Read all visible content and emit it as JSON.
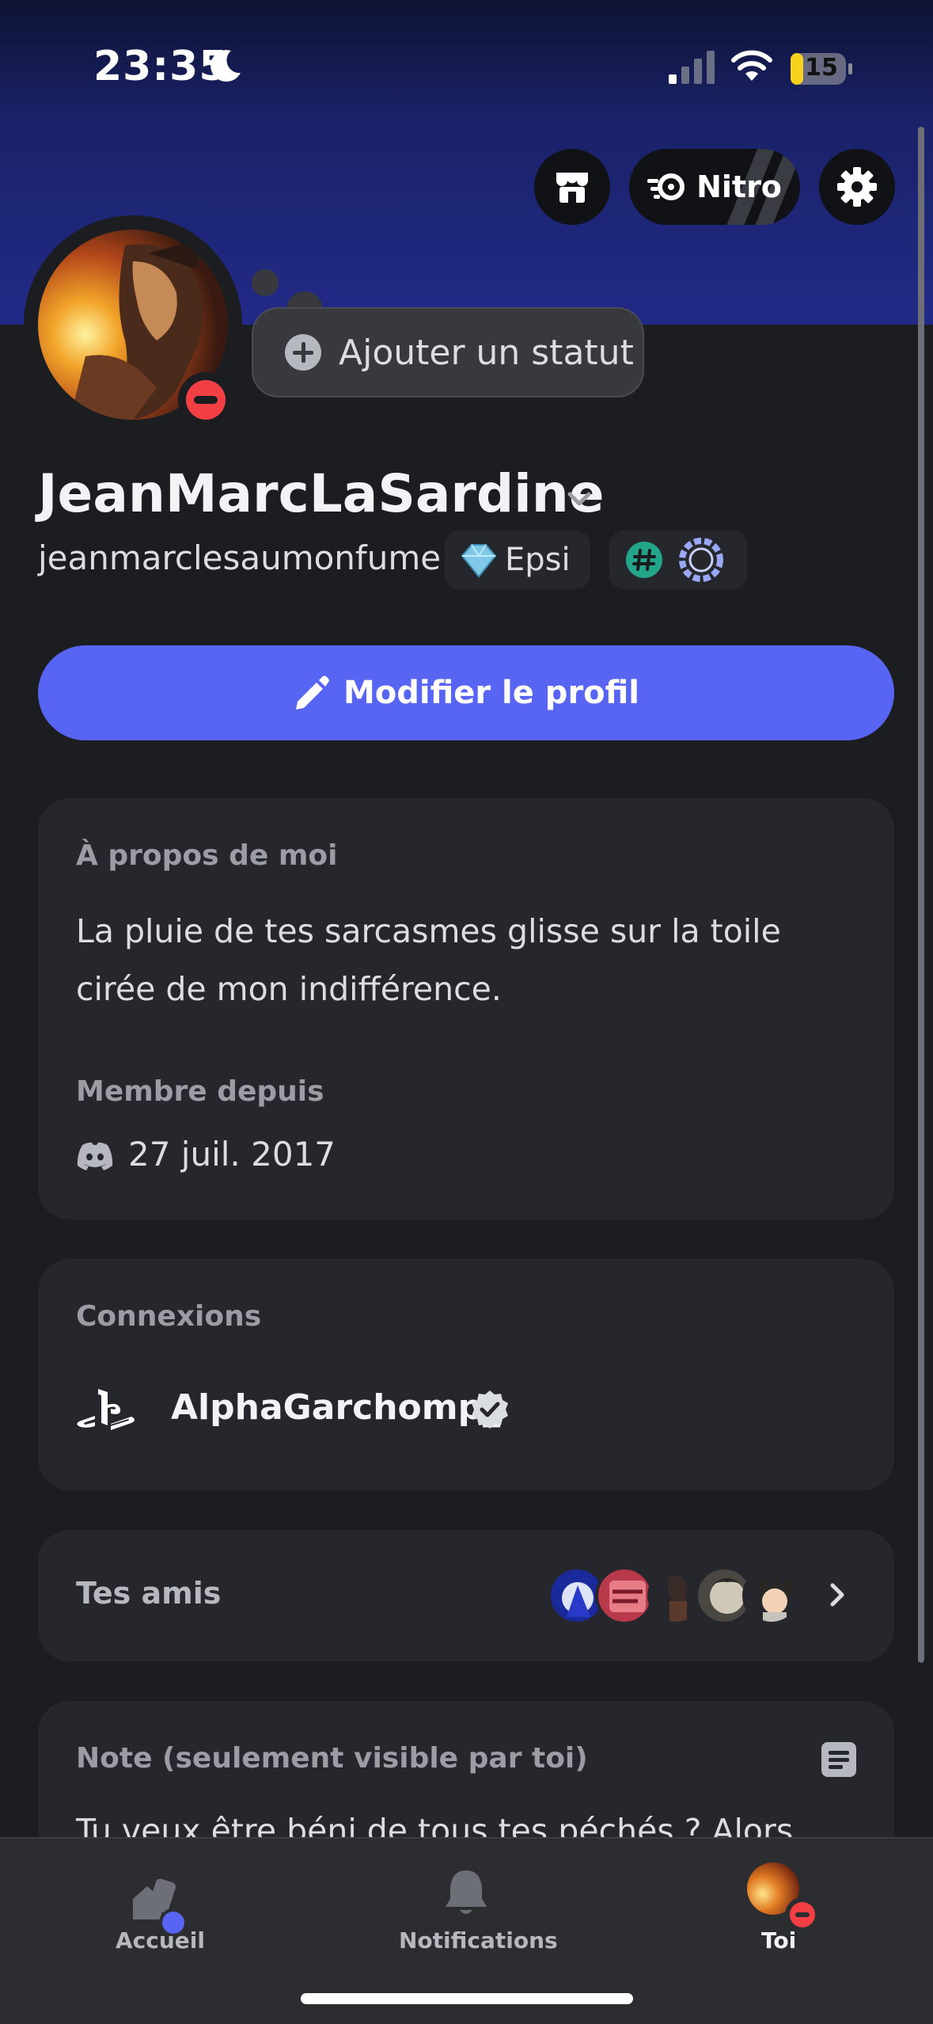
{
  "status_bar": {
    "time": "23:35",
    "battery": "15",
    "icons": [
      "moon-icon",
      "signal-icon",
      "wifi-icon",
      "battery-icon"
    ]
  },
  "header": {
    "nitro_label": "Nitro",
    "buttons": [
      "shop-icon",
      "nitro-icon",
      "gear-icon"
    ]
  },
  "profile": {
    "display_name": "JeanMarcLaSardine",
    "username": "jeanmarclesaumonfume",
    "status_placeholder": "Ajouter un statut",
    "guild_tag": "Epsi",
    "presence": "dnd",
    "edit_label": "Modifier le profil"
  },
  "about": {
    "title": "À propos de moi",
    "text": "La pluie de tes sarcasmes glisse sur la toile cirée de mon indifférence.",
    "member_since_title": "Membre depuis",
    "member_since": "27 juil. 2017"
  },
  "connections": {
    "title": "Connexions",
    "items": [
      {
        "platform": "PlayStation",
        "name": "AlphaGarchomp_",
        "verified": true
      }
    ]
  },
  "friends": {
    "label": "Tes amis",
    "count_avatars": 5
  },
  "note": {
    "title": "Note (seulement visible par toi)",
    "text": "Tu veux être béni de tous tes péchés ? Alors"
  },
  "nav": {
    "items": [
      {
        "label": "Accueil",
        "icon": "home-icon"
      },
      {
        "label": "Notifications",
        "icon": "bell-icon"
      },
      {
        "label": "Toi",
        "icon": "avatar"
      }
    ]
  },
  "colors": {
    "blurple": "#5865f2",
    "dnd_red": "#f23f43",
    "card": "#26272d",
    "background": "#1c1d21"
  }
}
